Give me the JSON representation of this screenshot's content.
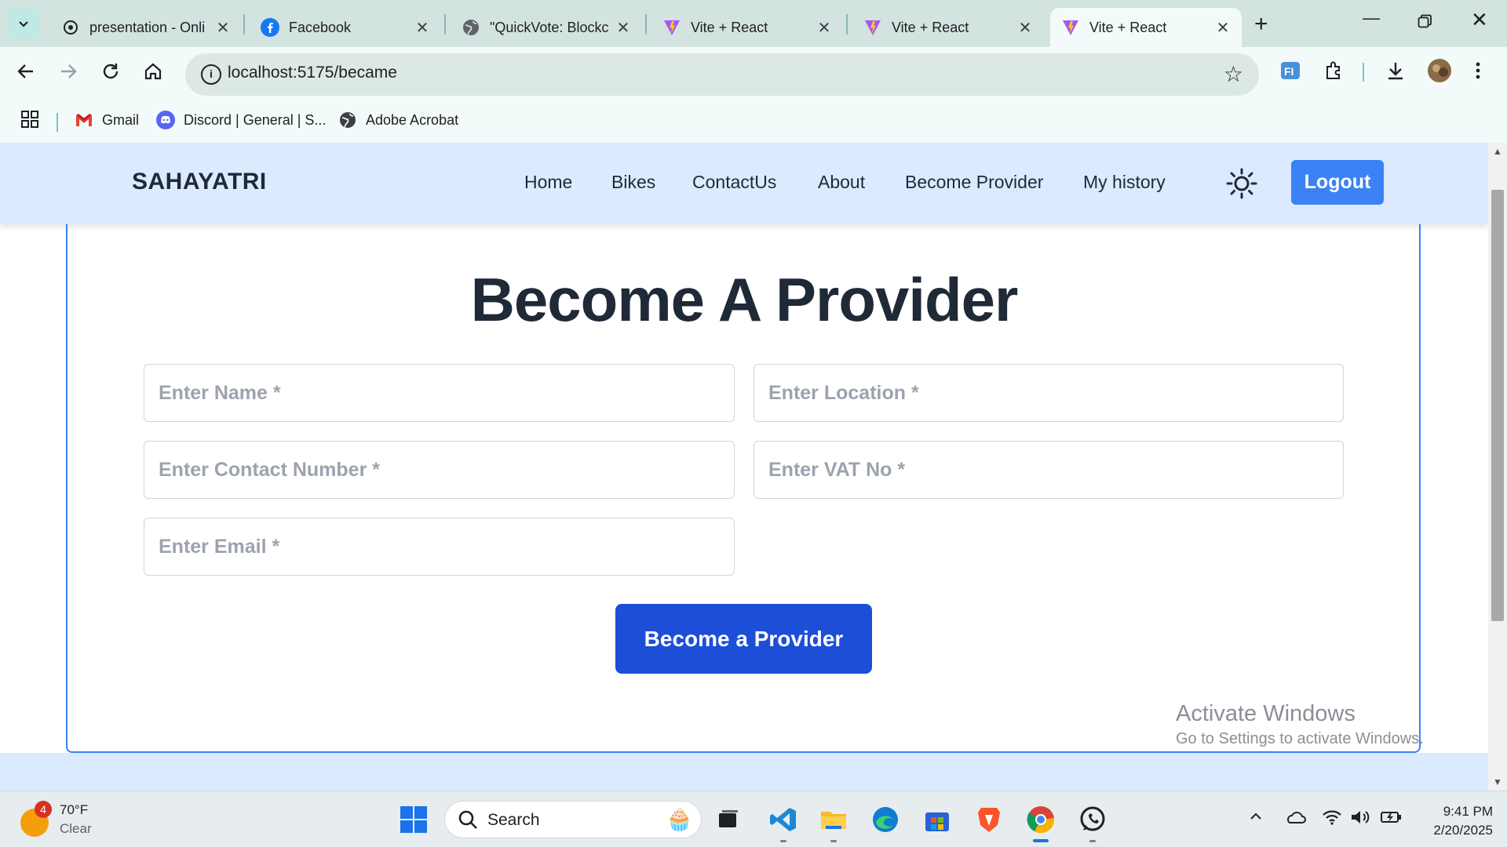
{
  "browser": {
    "tabs": [
      {
        "title": "presentation - Onli",
        "icon": "orbit-icon"
      },
      {
        "title": "Facebook",
        "icon": "facebook-icon"
      },
      {
        "title": "\"QuickVote: Blockc",
        "icon": "globe-icon"
      },
      {
        "title": "Vite + React",
        "icon": "vite-icon"
      },
      {
        "title": "Vite + React",
        "icon": "vite-icon"
      },
      {
        "title": "Vite + React",
        "icon": "vite-icon",
        "active": true
      }
    ],
    "url": "localhost:5175/became",
    "bookmarks": [
      {
        "label": "Gmail",
        "icon": "gmail-icon"
      },
      {
        "label": "Discord | General | S...",
        "icon": "discord-icon"
      },
      {
        "label": "Adobe Acrobat",
        "icon": "globe-icon"
      }
    ]
  },
  "site": {
    "brand": "SAHAYATRI",
    "nav": [
      "Home",
      "Bikes",
      "ContactUs",
      "About",
      "Become Provider",
      "My history"
    ],
    "logout_label": "Logout",
    "accent_color": "#3b82f6",
    "nav_bg_color": "#dbeafe"
  },
  "form": {
    "title": "Become A Provider",
    "name_placeholder": "Enter Name *",
    "location_placeholder": "Enter Location *",
    "contact_placeholder": "Enter Contact Number *",
    "vat_placeholder": "Enter VAT No *",
    "email_placeholder": "Enter Email *",
    "submit_label": "Become a Provider",
    "submit_color": "#1d4ed8"
  },
  "watermark": {
    "line1": "Activate Windows",
    "line2": "Go to Settings to activate Windows."
  },
  "taskbar": {
    "weather_temp": "70°F",
    "weather_desc": "Clear",
    "weather_badge": "4",
    "search_label": "Search",
    "time": "9:41 PM",
    "date": "2/20/2025"
  }
}
